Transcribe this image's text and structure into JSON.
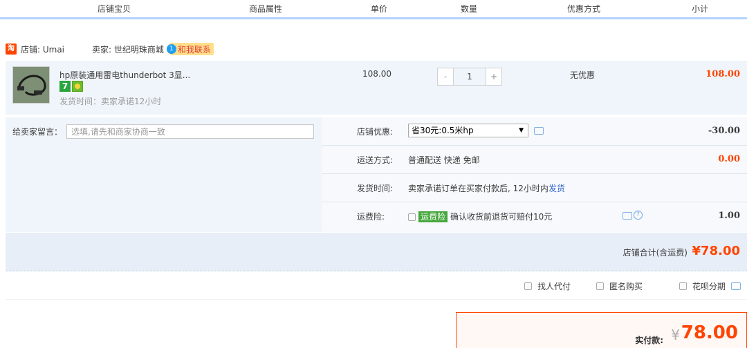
{
  "header": {
    "columns": [
      "店铺宝贝",
      "商品属性",
      "单价",
      "数量",
      "优惠方式",
      "小计"
    ]
  },
  "shop": {
    "icon_text": "淘",
    "shop_label": "店铺: Umai",
    "seller_label": "卖家: 世纪明珠商城",
    "contact_badge": "1",
    "contact_text": "和我联系"
  },
  "item": {
    "title": "hp原装通用雷电thunderbot 3显...",
    "badge_seven": "7",
    "ship_time": "发货时间：卖家承诺12小时",
    "price": "108.00",
    "qty_minus": "-",
    "qty_value": "1",
    "qty_plus": "+",
    "discount": "无优惠",
    "subtotal": "108.00"
  },
  "message": {
    "label": "给卖家留言：",
    "placeholder": "选填,请先和商家协商一致"
  },
  "options": {
    "shop_discount_label": "店铺优惠:",
    "shop_discount_select": "省30元:0.5米hp",
    "shop_discount_amount": "-30.00",
    "shipping_label": "运送方式:",
    "shipping_value": "普通配送 快递 免邮",
    "shipping_amount": "0.00",
    "deliver_label": "发货时间:",
    "deliver_value": "卖家承诺订单在买家付款后, 12小时内",
    "deliver_link": "发货",
    "insurance_label": "运费险:",
    "insurance_tag": "运费险",
    "insurance_text": "确认收货前退货可赔付10元",
    "insurance_amount": "1.00"
  },
  "total": {
    "label": "店铺合计(含运费)",
    "amount": "¥78.00"
  },
  "extras": {
    "agent_pay": "找人代付",
    "anonymous": "匿名购买",
    "huabei": "花呗分期"
  },
  "pay": {
    "label": "实付款:",
    "yen": "¥",
    "amount": "78.00"
  },
  "colors": {
    "accent": "#ff4400",
    "header_underline": "#b2d1ff",
    "row_bg": "#f0f5fb"
  }
}
